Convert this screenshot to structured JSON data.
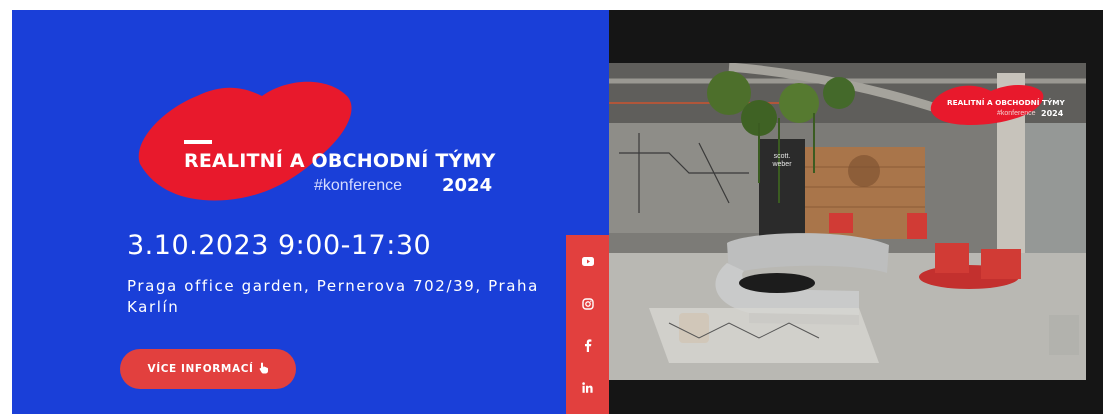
{
  "event": {
    "title": "REALITNÍ A OBCHODNÍ TÝMY",
    "hashtag": "#konference",
    "year": "2024",
    "date_time": "3.10.2023 9:00-17:30",
    "venue": "Praga office garden, Pernerova 702/39, Praha Karlín"
  },
  "cta": {
    "label": "VÍCE INFORMACÍ",
    "icon": "hand-pointer-icon"
  },
  "social": [
    {
      "name": "youtube",
      "icon": "youtube-icon"
    },
    {
      "name": "instagram",
      "icon": "instagram-icon"
    },
    {
      "name": "facebook",
      "icon": "facebook-icon"
    },
    {
      "name": "linkedin",
      "icon": "linkedin-icon"
    }
  ],
  "photo": {
    "badge_title": "REALITNÍ A OBCHODNÍ TÝMY",
    "badge_hashtag": "#konference",
    "badge_year": "2024",
    "wall_logo": "scott. weber"
  },
  "colors": {
    "panel_blue": "#1a3fd8",
    "accent_red": "#e2403e",
    "lips_red": "#e8192c",
    "dark_bg": "#151515"
  }
}
